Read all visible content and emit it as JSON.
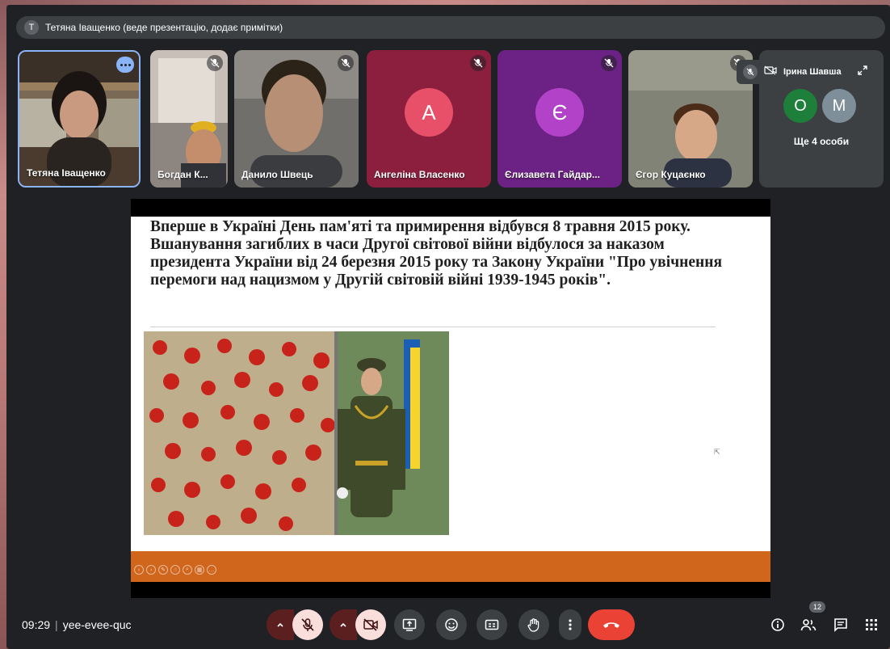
{
  "presenter_bar": {
    "avatar_letter": "Т",
    "text": "Тетяна Іващенко (веде презентацію, додає примітки)"
  },
  "participants": [
    {
      "name": "Тетяна Іващенко",
      "muted": false,
      "pinned_options": true
    },
    {
      "name": "Богдан К...",
      "muted": true
    },
    {
      "name": "Данило Швець",
      "muted": true
    },
    {
      "name": "Ангеліна Власенко",
      "muted": true,
      "avatar_letter": "A",
      "avatar_color": "#e8506a",
      "tile_color": "#8c1f3e"
    },
    {
      "name": "Єлизавета Гайдар...",
      "muted": true,
      "avatar_letter": "Є",
      "avatar_color": "#b243c8",
      "tile_color": "#6c2184"
    },
    {
      "name": "Єгор Куцаєнко",
      "muted": true
    }
  ],
  "overflow_tile": {
    "hover_name": "Ірина Шавша",
    "avatars": [
      {
        "letter": "О",
        "color": "#1e7f3a"
      },
      {
        "letter": "М",
        "color": "#7f8f9a"
      }
    ],
    "more_label": "Ще 4 особи"
  },
  "slide": {
    "text": "Вперше в Україні День пам'яті та примирення відбувся 8 травня 2015 року. Вшанування загиблих в часи Другої світової війни відбулося за наказом президента України від 24 березня 2015 року та Закону України \"Про увічнення перемоги над нацизмом у Другій світовій війні 1939-1945 років\".",
    "bar_color": "#d0651c"
  },
  "bottom_bar": {
    "time": "09:29",
    "meeting_code": "yee-evee-quc",
    "participants_count": "12"
  },
  "icons": [
    "mic-off-icon",
    "video-off-icon",
    "present-icon",
    "emoji-icon",
    "captions-icon",
    "raise-hand-icon",
    "more-vert-icon",
    "end-call-icon",
    "info-icon",
    "people-icon",
    "chat-icon",
    "apps-icon"
  ]
}
